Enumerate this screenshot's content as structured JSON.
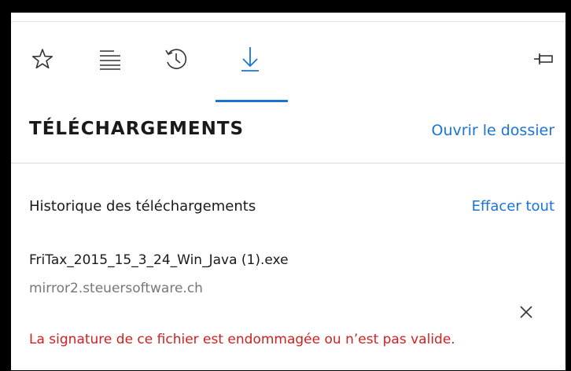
{
  "hub": {
    "toolbar": {
      "icons": [
        "star-icon",
        "reading-list-icon",
        "history-icon",
        "download-icon"
      ],
      "active_tab": "download-icon",
      "pin_icon": "pin-icon"
    },
    "title": "TÉLÉCHARGEMENTS",
    "open_folder_label": "Ouvrir le dossier",
    "history_label": "Historique des téléchargements",
    "clear_all_label": "Effacer tout",
    "downloads": [
      {
        "filename": "FriTax_2015_15_3_24_Win_Java (1).exe",
        "source": "mirror2.steuersoftware.ch",
        "error": "La signature de ce fichier est endommagée ou n’est pas valide."
      }
    ]
  },
  "colors": {
    "accent": "#1a73d6",
    "error": "#d12020",
    "muted": "#777777",
    "frame": "#000000"
  }
}
